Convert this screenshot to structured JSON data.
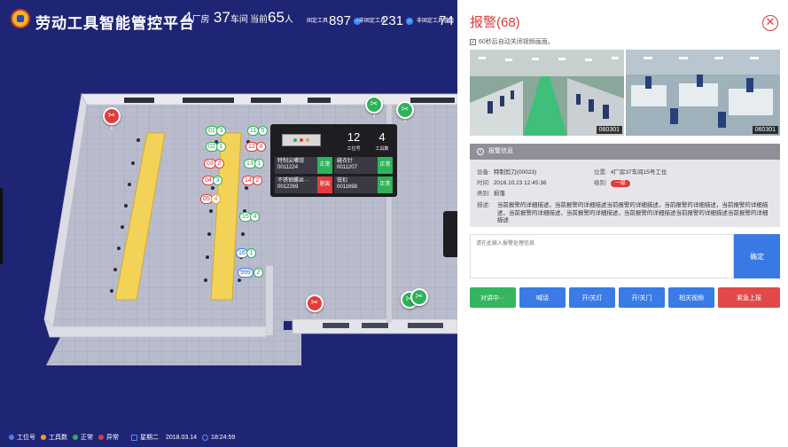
{
  "header": {
    "title": "劳动工具智能管控平台",
    "factory_num": "4",
    "factory_unit": "厂房",
    "workshop_num": "37",
    "workshop_unit": "车间",
    "current_label": "当前",
    "current_num": "65",
    "current_unit": "人",
    "kpis": [
      {
        "label": "固定工具",
        "value": "897"
      },
      {
        "label": "非固定工具",
        "value": "231"
      },
      {
        "label": "非固定工具借用",
        "value": "74"
      }
    ]
  },
  "floor": {
    "left_tags": [
      {
        "text": "01",
        "kind": "g"
      },
      {
        "text": "02",
        "kind": "g"
      },
      {
        "text": "03",
        "kind": "r"
      },
      {
        "text": "04",
        "kind": "r"
      },
      {
        "text": "05",
        "kind": "r"
      }
    ],
    "left_tag_values": [
      "3",
      "1",
      "2",
      "3",
      "4"
    ],
    "right_tags": [
      {
        "text": "11",
        "kind": "g",
        "val": "5"
      },
      {
        "text": "12",
        "kind": "r",
        "val": "4"
      },
      {
        "text": "13",
        "kind": "g",
        "val": "1"
      },
      {
        "text": "14",
        "kind": "r",
        "val": "2"
      },
      {
        "text": "15",
        "kind": "g",
        "val": "4"
      },
      {
        "text": "16",
        "kind": "b",
        "val": "1"
      },
      {
        "text": "999",
        "kind": "b",
        "val": "2"
      }
    ],
    "tool_card": {
      "work_no_value": "12",
      "work_no_label": "工位号",
      "tool_count_value": "4",
      "tool_count_label": "工具数",
      "items": [
        {
          "name": "特制尖嘴钳",
          "code": "0011224",
          "status": "正常",
          "ok": true
        },
        {
          "name": "缝衣针",
          "code": "0011207",
          "status": "正常",
          "ok": true
        },
        {
          "name": "不锈钢螺丝···",
          "code": "0012269",
          "status": "脱离",
          "ok": false
        },
        {
          "name": "钳扣",
          "code": "0011698",
          "status": "正常",
          "ok": true
        }
      ]
    }
  },
  "footer": {
    "legend": [
      {
        "label": "工位号",
        "color": "#4b7ef0"
      },
      {
        "label": "工具数",
        "color": "#f19a3b"
      },
      {
        "label": "正常",
        "color": "#2fb25a"
      },
      {
        "label": "异常",
        "color": "#e23b3b"
      }
    ],
    "weekday": "星期二",
    "date": "2018.03.14",
    "time": "18:24:59"
  },
  "alarm": {
    "title": "报警(68)",
    "close_icon": "✕",
    "auto_close_text": "60秒后自动关闭视频画面。",
    "videos": [
      {
        "cam_id": "060301"
      },
      {
        "cam_id": "060301"
      }
    ],
    "info_header": "报警信息",
    "device_label": "设备:",
    "device_value": "特制剪刀(00023)",
    "location_label": "位置:",
    "location_value": "4厂房37车间15号工位",
    "time_label": "时间:",
    "time_value": "2016.10.23 12:45:36",
    "level_label": "级别:",
    "level_value": "一级",
    "type_label": "类别:",
    "type_value": "损落",
    "desc_label": "描述:",
    "desc_value": "当前报警的详细描述，当前报警的详细描述当前报警的详细描述，当前报警的详细描述，当前报警的详细描述，当前报警的详细描述，当前报警的详细描述，当前报警的详细描述当前报警的详细描述当前报警的详细描述",
    "note_placeholder": "请在此输入报警处理信息",
    "confirm_label": "确定",
    "actions": [
      {
        "label": "对讲中···",
        "color": "green"
      },
      {
        "label": "喊话",
        "color": "blue"
      },
      {
        "label": "开/关灯",
        "color": "blue"
      },
      {
        "label": "开/关门",
        "color": "blue"
      },
      {
        "label": "相关视频",
        "color": "blue"
      },
      {
        "label": "紧急上报",
        "color": "red"
      }
    ]
  }
}
